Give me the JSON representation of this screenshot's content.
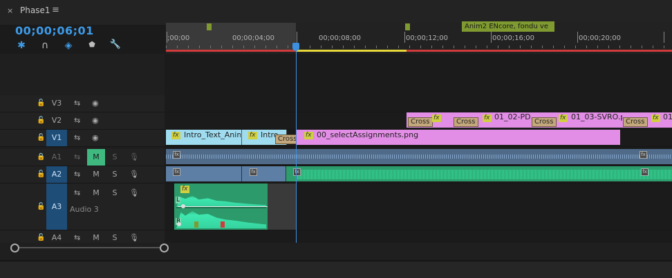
{
  "panel": {
    "close": "×",
    "title": "Phase1",
    "menu": "≡",
    "timecode": "00;00;06;01"
  },
  "toolbar": [
    {
      "name": "snap-icon",
      "glyph": "✱"
    },
    {
      "name": "linked-selection-icon",
      "glyph": "∩"
    },
    {
      "name": "track-select-icon",
      "glyph": "◈"
    },
    {
      "name": "add-marker-icon",
      "glyph": "⬟"
    },
    {
      "name": "wrench-icon",
      "glyph": "🔧"
    }
  ],
  "ruler": {
    "ticks": [
      ";00;00",
      "00;00;04;00",
      "00;00;08;00",
      "00;00;12;00",
      "00;00;16;00",
      "00;00;20;00"
    ],
    "marker_label": "Anim2 ENcore, fondu ve"
  },
  "tracks": {
    "video": [
      {
        "id": "V3",
        "lock": "🔓",
        "sync": "⇆",
        "eye": "◉"
      },
      {
        "id": "V2",
        "lock": "🔓",
        "sync": "⇆",
        "eye": "◉"
      },
      {
        "id": "V1",
        "lock": "🔓",
        "sync": "⇆",
        "eye": "◉"
      }
    ],
    "audio": [
      {
        "id": "A1",
        "lock": "🔒",
        "sync": "⇆",
        "mute": "M",
        "solo": "S",
        "mic": "🎙"
      },
      {
        "id": "A2",
        "lock": "🔓",
        "sync": "⇆",
        "mute": "M",
        "solo": "S",
        "mic": "🎙"
      },
      {
        "id": "A3",
        "lock": "🔓",
        "sync": "⇆",
        "mute": "M",
        "solo": "S",
        "mic": "🎙",
        "name": "Audio 3"
      },
      {
        "id": "A4",
        "lock": "🔓",
        "sync": "⇆",
        "mute": "M",
        "solo": "S",
        "mic": "🎙"
      }
    ]
  },
  "clips": {
    "v1_intro1": "Intro_Text_Anim",
    "v1_intro2": "Intro",
    "v1_cross": "Cross",
    "v1_main": "00_selectAssignments.png",
    "v2_cross1": "Cross",
    "v2_cross2": "Cross",
    "v2_clip1": "01_02-PD.",
    "v2_cross3": "Cross",
    "v2_clip2": "01_03-SVRO.p",
    "v2_cross4": "Cross",
    "v2_clip3": "01",
    "fx": "fx",
    "a3_fx": "fx",
    "a3_L": "L",
    "a3_R": "R"
  },
  "colors": {
    "accent": "#3d9be9",
    "video_clip_cyan": "#9fdcf0",
    "video_clip_pink": "#e38ee6",
    "audio_clip_blue": "#5d7fa5",
    "audio_clip_green": "#2e9d6e",
    "marker": "#7f9a30"
  }
}
